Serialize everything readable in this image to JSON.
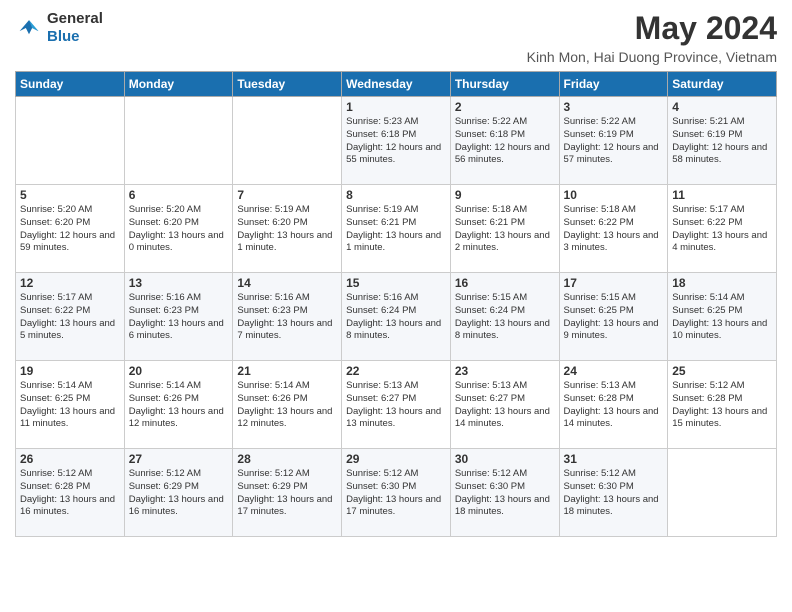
{
  "header": {
    "logo_general": "General",
    "logo_blue": "Blue",
    "month_year": "May 2024",
    "location": "Kinh Mon, Hai Duong Province, Vietnam"
  },
  "days_of_week": [
    "Sunday",
    "Monday",
    "Tuesday",
    "Wednesday",
    "Thursday",
    "Friday",
    "Saturday"
  ],
  "weeks": [
    [
      {
        "day": "",
        "sunrise": "",
        "sunset": "",
        "daylight": ""
      },
      {
        "day": "",
        "sunrise": "",
        "sunset": "",
        "daylight": ""
      },
      {
        "day": "",
        "sunrise": "",
        "sunset": "",
        "daylight": ""
      },
      {
        "day": "1",
        "sunrise": "Sunrise: 5:23 AM",
        "sunset": "Sunset: 6:18 PM",
        "daylight": "Daylight: 12 hours and 55 minutes."
      },
      {
        "day": "2",
        "sunrise": "Sunrise: 5:22 AM",
        "sunset": "Sunset: 6:18 PM",
        "daylight": "Daylight: 12 hours and 56 minutes."
      },
      {
        "day": "3",
        "sunrise": "Sunrise: 5:22 AM",
        "sunset": "Sunset: 6:19 PM",
        "daylight": "Daylight: 12 hours and 57 minutes."
      },
      {
        "day": "4",
        "sunrise": "Sunrise: 5:21 AM",
        "sunset": "Sunset: 6:19 PM",
        "daylight": "Daylight: 12 hours and 58 minutes."
      }
    ],
    [
      {
        "day": "5",
        "sunrise": "Sunrise: 5:20 AM",
        "sunset": "Sunset: 6:20 PM",
        "daylight": "Daylight: 12 hours and 59 minutes."
      },
      {
        "day": "6",
        "sunrise": "Sunrise: 5:20 AM",
        "sunset": "Sunset: 6:20 PM",
        "daylight": "Daylight: 13 hours and 0 minutes."
      },
      {
        "day": "7",
        "sunrise": "Sunrise: 5:19 AM",
        "sunset": "Sunset: 6:20 PM",
        "daylight": "Daylight: 13 hours and 1 minute."
      },
      {
        "day": "8",
        "sunrise": "Sunrise: 5:19 AM",
        "sunset": "Sunset: 6:21 PM",
        "daylight": "Daylight: 13 hours and 1 minute."
      },
      {
        "day": "9",
        "sunrise": "Sunrise: 5:18 AM",
        "sunset": "Sunset: 6:21 PM",
        "daylight": "Daylight: 13 hours and 2 minutes."
      },
      {
        "day": "10",
        "sunrise": "Sunrise: 5:18 AM",
        "sunset": "Sunset: 6:22 PM",
        "daylight": "Daylight: 13 hours and 3 minutes."
      },
      {
        "day": "11",
        "sunrise": "Sunrise: 5:17 AM",
        "sunset": "Sunset: 6:22 PM",
        "daylight": "Daylight: 13 hours and 4 minutes."
      }
    ],
    [
      {
        "day": "12",
        "sunrise": "Sunrise: 5:17 AM",
        "sunset": "Sunset: 6:22 PM",
        "daylight": "Daylight: 13 hours and 5 minutes."
      },
      {
        "day": "13",
        "sunrise": "Sunrise: 5:16 AM",
        "sunset": "Sunset: 6:23 PM",
        "daylight": "Daylight: 13 hours and 6 minutes."
      },
      {
        "day": "14",
        "sunrise": "Sunrise: 5:16 AM",
        "sunset": "Sunset: 6:23 PM",
        "daylight": "Daylight: 13 hours and 7 minutes."
      },
      {
        "day": "15",
        "sunrise": "Sunrise: 5:16 AM",
        "sunset": "Sunset: 6:24 PM",
        "daylight": "Daylight: 13 hours and 8 minutes."
      },
      {
        "day": "16",
        "sunrise": "Sunrise: 5:15 AM",
        "sunset": "Sunset: 6:24 PM",
        "daylight": "Daylight: 13 hours and 8 minutes."
      },
      {
        "day": "17",
        "sunrise": "Sunrise: 5:15 AM",
        "sunset": "Sunset: 6:25 PM",
        "daylight": "Daylight: 13 hours and 9 minutes."
      },
      {
        "day": "18",
        "sunrise": "Sunrise: 5:14 AM",
        "sunset": "Sunset: 6:25 PM",
        "daylight": "Daylight: 13 hours and 10 minutes."
      }
    ],
    [
      {
        "day": "19",
        "sunrise": "Sunrise: 5:14 AM",
        "sunset": "Sunset: 6:25 PM",
        "daylight": "Daylight: 13 hours and 11 minutes."
      },
      {
        "day": "20",
        "sunrise": "Sunrise: 5:14 AM",
        "sunset": "Sunset: 6:26 PM",
        "daylight": "Daylight: 13 hours and 12 minutes."
      },
      {
        "day": "21",
        "sunrise": "Sunrise: 5:14 AM",
        "sunset": "Sunset: 6:26 PM",
        "daylight": "Daylight: 13 hours and 12 minutes."
      },
      {
        "day": "22",
        "sunrise": "Sunrise: 5:13 AM",
        "sunset": "Sunset: 6:27 PM",
        "daylight": "Daylight: 13 hours and 13 minutes."
      },
      {
        "day": "23",
        "sunrise": "Sunrise: 5:13 AM",
        "sunset": "Sunset: 6:27 PM",
        "daylight": "Daylight: 13 hours and 14 minutes."
      },
      {
        "day": "24",
        "sunrise": "Sunrise: 5:13 AM",
        "sunset": "Sunset: 6:28 PM",
        "daylight": "Daylight: 13 hours and 14 minutes."
      },
      {
        "day": "25",
        "sunrise": "Sunrise: 5:12 AM",
        "sunset": "Sunset: 6:28 PM",
        "daylight": "Daylight: 13 hours and 15 minutes."
      }
    ],
    [
      {
        "day": "26",
        "sunrise": "Sunrise: 5:12 AM",
        "sunset": "Sunset: 6:28 PM",
        "daylight": "Daylight: 13 hours and 16 minutes."
      },
      {
        "day": "27",
        "sunrise": "Sunrise: 5:12 AM",
        "sunset": "Sunset: 6:29 PM",
        "daylight": "Daylight: 13 hours and 16 minutes."
      },
      {
        "day": "28",
        "sunrise": "Sunrise: 5:12 AM",
        "sunset": "Sunset: 6:29 PM",
        "daylight": "Daylight: 13 hours and 17 minutes."
      },
      {
        "day": "29",
        "sunrise": "Sunrise: 5:12 AM",
        "sunset": "Sunset: 6:30 PM",
        "daylight": "Daylight: 13 hours and 17 minutes."
      },
      {
        "day": "30",
        "sunrise": "Sunrise: 5:12 AM",
        "sunset": "Sunset: 6:30 PM",
        "daylight": "Daylight: 13 hours and 18 minutes."
      },
      {
        "day": "31",
        "sunrise": "Sunrise: 5:12 AM",
        "sunset": "Sunset: 6:30 PM",
        "daylight": "Daylight: 13 hours and 18 minutes."
      },
      {
        "day": "",
        "sunrise": "",
        "sunset": "",
        "daylight": ""
      }
    ]
  ]
}
